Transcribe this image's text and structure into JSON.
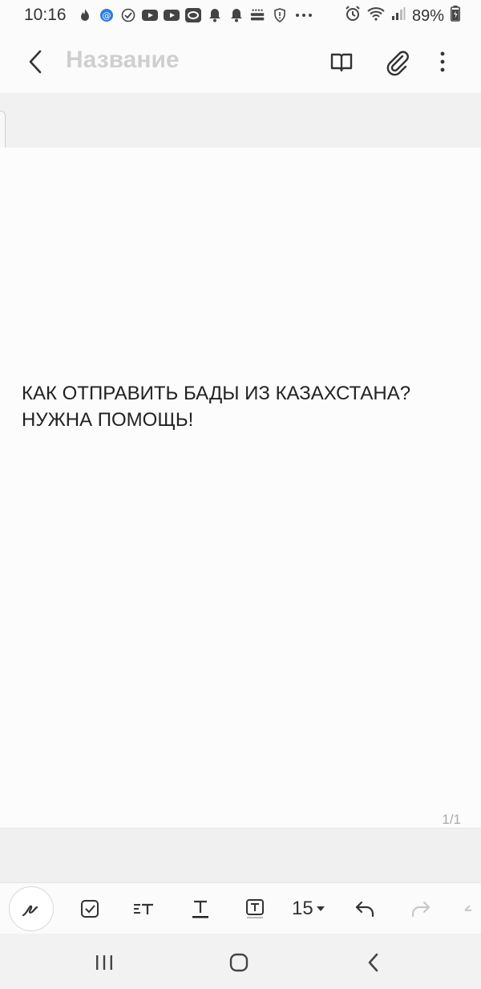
{
  "status_bar": {
    "time": "10:16",
    "battery": "89%",
    "icons_left": [
      "flame-icon",
      "mail-icon",
      "check-circle-icon",
      "youtube-icon",
      "youtube-icon",
      "ring-icon",
      "bell-icon",
      "bell-icon",
      "detmir-icon",
      "shield-icon",
      "more-dots-icon"
    ],
    "icons_right": [
      "alarm-icon",
      "wifi-icon",
      "signal-icon",
      "battery-icon"
    ]
  },
  "app_bar": {
    "title_placeholder": "Название",
    "actions": [
      "book-icon",
      "paperclip-icon",
      "more-vertical-icon"
    ]
  },
  "note": {
    "line1": "КАК ОТПРАВИТЬ БАДЫ ИЗ КАЗАХСТАНА?",
    "line2": "НУЖНА ПОМОЩЬ!",
    "page_indicator": "1/1"
  },
  "toolbar": {
    "font_size": "15",
    "tools": [
      "pen-icon",
      "checkbox-icon",
      "text-style-icon",
      "text-underline-icon",
      "text-box-icon",
      "font-size-dropdown",
      "undo-icon",
      "redo-icon",
      "more-tool-icon"
    ]
  },
  "colors": {
    "background": "#f6f6f6",
    "page": "#fcfcfc",
    "title_placeholder": "#cfcfcf",
    "icon": "#333333"
  }
}
